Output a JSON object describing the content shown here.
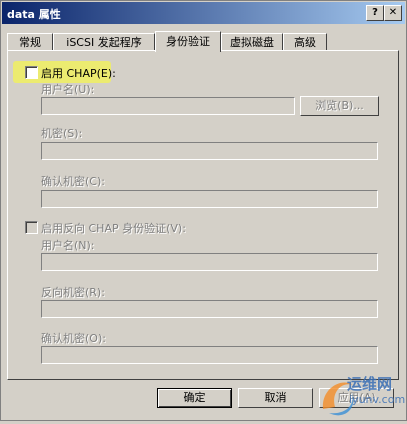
{
  "window": {
    "title": "data 属性",
    "help_button": "?",
    "close_button": "✕"
  },
  "tabs": [
    {
      "label": "常规"
    },
    {
      "label": "iSCSI 发起程序"
    },
    {
      "label": "身份验证"
    },
    {
      "label": "虚拟磁盘"
    },
    {
      "label": "高级"
    }
  ],
  "chap": {
    "enable_label": "启用 CHAP(E):",
    "enabled": false,
    "username_label": "用户名(U):",
    "username_value": "",
    "browse_button": "浏览(B)...",
    "secret_label": "机密(S):",
    "secret_value": "",
    "confirm_secret_label": "确认机密(C):",
    "confirm_secret_value": ""
  },
  "reverse_chap": {
    "enable_label": "启用反向 CHAP 身份验证(V):",
    "enabled": false,
    "username_label": "用户名(N):",
    "username_value": "",
    "secret_label": "反向机密(R):",
    "secret_value": "",
    "confirm_secret_label": "确认机密(O):",
    "confirm_secret_value": ""
  },
  "footer": {
    "ok_button": "确定",
    "cancel_button": "取消",
    "apply_button": "应用(A)"
  },
  "watermark": {
    "line1": "运维网",
    "line2": "iyunv.com"
  },
  "colors": {
    "highlight": "#f0f060",
    "titlebar_start": "#0a246a",
    "titlebar_end": "#a6caf0"
  }
}
